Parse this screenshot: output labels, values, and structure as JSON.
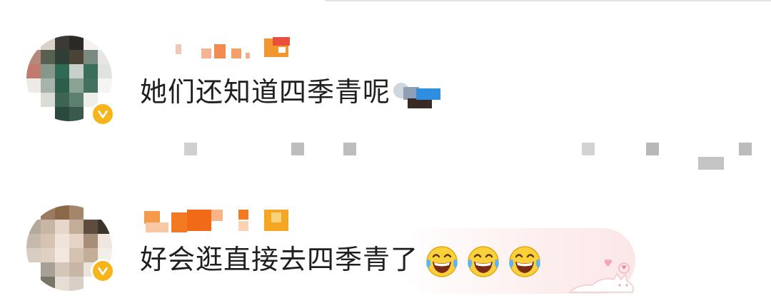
{
  "comments": [
    {
      "text": "她们还知道四季青呢",
      "verified": true
    },
    {
      "text": "好会逛直接去四季青了",
      "emojis": [
        "laughing-with-tears",
        "laughing-with-tears",
        "laughing-with-tears"
      ],
      "verified": true
    }
  ],
  "colors": {
    "verify_badge": "#f5b51b",
    "username_orange": "#f57c1f",
    "text": "#1f1f1f"
  }
}
